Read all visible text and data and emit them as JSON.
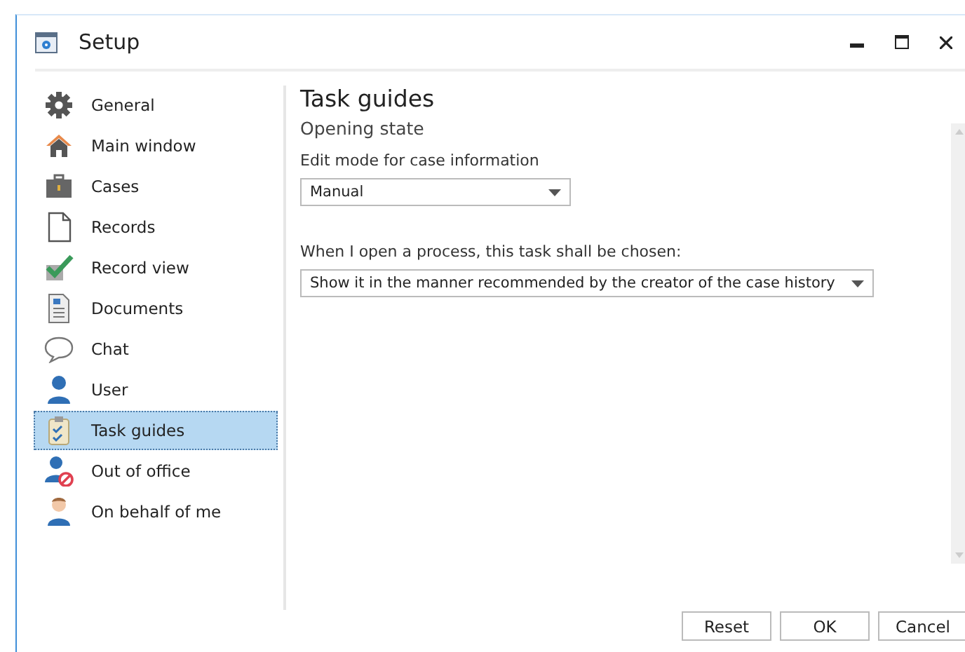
{
  "window": {
    "title": "Setup"
  },
  "sidebar": {
    "items": [
      {
        "label": "General",
        "selected": false
      },
      {
        "label": "Main window",
        "selected": false
      },
      {
        "label": "Cases",
        "selected": false
      },
      {
        "label": "Records",
        "selected": false
      },
      {
        "label": "Record view",
        "selected": false
      },
      {
        "label": "Documents",
        "selected": false
      },
      {
        "label": "Chat",
        "selected": false
      },
      {
        "label": "User",
        "selected": false
      },
      {
        "label": "Task guides",
        "selected": true
      },
      {
        "label": "Out of office",
        "selected": false
      },
      {
        "label": "On behalf of me",
        "selected": false
      }
    ]
  },
  "content": {
    "heading": "Task guides",
    "subheading": "Opening state",
    "fields": [
      {
        "label": "Edit mode for case information",
        "value": "Manual"
      },
      {
        "label": "When I open a process, this task shall be chosen:",
        "value": "Show it in the manner recommended by the creator of the case history"
      }
    ]
  },
  "buttons": [
    "Reset",
    "OK",
    "Cancel"
  ]
}
